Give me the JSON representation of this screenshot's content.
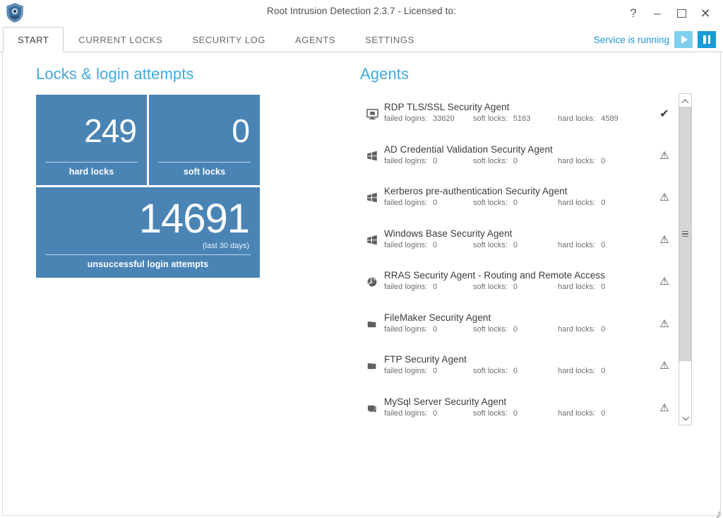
{
  "window": {
    "title": "Root Intrusion Detection 2.3.7 - Licensed to:",
    "logo_icon": "shield-icon",
    "controls": {
      "help": "?",
      "minimize": "–",
      "maximize": "maximize-icon",
      "close": "✕"
    }
  },
  "tabs": [
    {
      "label": "START",
      "active": true
    },
    {
      "label": "CURRENT LOCKS",
      "active": false
    },
    {
      "label": "SECURITY LOG",
      "active": false
    },
    {
      "label": "AGENTS",
      "active": false
    },
    {
      "label": "SETTINGS",
      "active": false
    }
  ],
  "service": {
    "status_text": "Service is running",
    "start_icon": "play-icon",
    "pause_icon": "pause-icon",
    "start_enabled": false,
    "pause_enabled": true
  },
  "locks_panel": {
    "heading": "Locks & login attempts",
    "tiles": [
      {
        "value": "249",
        "caption": "hard locks",
        "note": ""
      },
      {
        "value": "0",
        "caption": "soft locks",
        "note": ""
      },
      {
        "value": "14691",
        "caption": "unsuccessful login attempts",
        "note": "(last 30 days)"
      }
    ]
  },
  "agents_panel": {
    "heading": "Agents",
    "stat_labels": {
      "failed_logins": "failed logins:",
      "soft_locks": "soft locks:",
      "hard_locks": "hard locks:"
    },
    "rows": [
      {
        "name": "RDP TLS/SSL Security Agent",
        "icon": "monitor-icon",
        "failed_logins": "33620",
        "soft_locks": "5163",
        "hard_locks": "4589",
        "status": "ok",
        "status_glyph": "✔"
      },
      {
        "name": "AD Credential Validation Security Agent",
        "icon": "windows-flag-icon",
        "failed_logins": "0",
        "soft_locks": "0",
        "hard_locks": "0",
        "status": "warning",
        "status_glyph": "⚠"
      },
      {
        "name": "Kerberos pre-authentication Security Agent",
        "icon": "windows-flag-icon",
        "failed_logins": "0",
        "soft_locks": "0",
        "hard_locks": "0",
        "status": "warning",
        "status_glyph": "⚠"
      },
      {
        "name": "Windows Base Security Agent",
        "icon": "windows-flag-icon",
        "failed_logins": "0",
        "soft_locks": "0",
        "hard_locks": "0",
        "status": "warning",
        "status_glyph": "⚠"
      },
      {
        "name": "RRAS Security Agent - Routing and Remote Access",
        "icon": "globe-icon",
        "failed_logins": "0",
        "soft_locks": "0",
        "hard_locks": "0",
        "status": "warning",
        "status_glyph": "⚠"
      },
      {
        "name": "FileMaker Security Agent",
        "icon": "folder-icon",
        "failed_logins": "0",
        "soft_locks": "0",
        "hard_locks": "0",
        "status": "warning",
        "status_glyph": "⚠"
      },
      {
        "name": "FTP Security Agent",
        "icon": "folder-icon",
        "failed_logins": "0",
        "soft_locks": "0",
        "hard_locks": "0",
        "status": "warning",
        "status_glyph": "⚠"
      },
      {
        "name": "MySql Server Security Agent",
        "icon": "database-icon",
        "failed_logins": "0",
        "soft_locks": "0",
        "hard_locks": "0",
        "status": "warning",
        "status_glyph": "⚠"
      }
    ],
    "scrollbar": {
      "up_icon": "chevron-up-icon",
      "down_icon": "chevron-down-icon"
    }
  },
  "colors": {
    "tile_blue": "#4a84b5",
    "heading_blue": "#3fa9e0",
    "accent_blue": "#189bd7",
    "accent_blue_light": "#7fd0f0"
  }
}
